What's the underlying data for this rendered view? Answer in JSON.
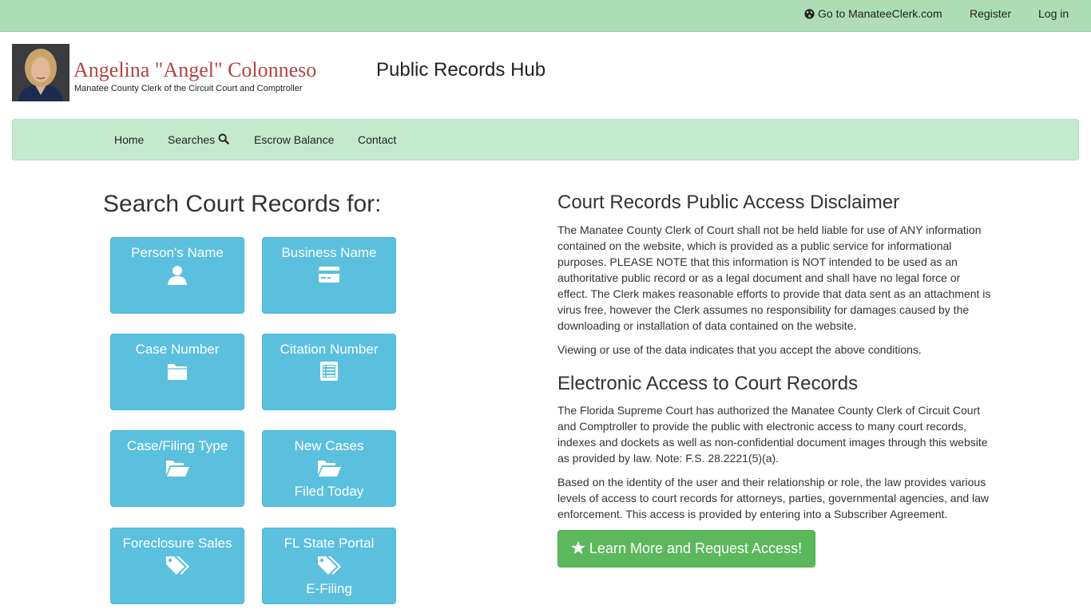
{
  "topbar": {
    "goto_label": "Go to ManateeClerk.com",
    "register_label": "Register",
    "login_label": "Log in"
  },
  "brand": {
    "name": "Angelina \"Angel\" Colonneso",
    "subtitle": "Manatee County Clerk of the Circuit Court and Comptroller",
    "hub_title": "Public Records Hub"
  },
  "nav": {
    "home": "Home",
    "searches": "Searches",
    "escrow": "Escrow Balance",
    "contact": "Contact"
  },
  "search": {
    "title": "Search Court Records for:",
    "tiles": [
      {
        "label": "Person's Name",
        "icon": "user-icon"
      },
      {
        "label": "Business Name",
        "icon": "credit-card-icon"
      },
      {
        "label": "Case Number",
        "icon": "folder-icon"
      },
      {
        "label": "Citation Number",
        "icon": "list-alt-icon"
      },
      {
        "label": "Case/Filing Type",
        "icon": "folder-open-icon"
      },
      {
        "label": "New Cases",
        "sublabel": "Filed Today",
        "icon": "folder-open-icon"
      },
      {
        "label": "Foreclosure Sales",
        "icon": "tags-icon"
      },
      {
        "label": "FL State Portal",
        "sublabel": "E-Filing",
        "icon": "tags-icon"
      }
    ]
  },
  "disclaimer": {
    "title": "Court Records Public Access Disclaimer",
    "p1": "The Manatee County Clerk of Court shall not be held liable for use of ANY information contained on the website, which is provided as a public service for informational purposes. PLEASE NOTE that this information is NOT intended to be used as an authoritative public record or as a legal document and shall have no legal force or effect. The Clerk makes reasonable efforts to provide that data sent as an attachment is virus free, however the Clerk assumes no responsibility for damages caused by the downloading or installation of data contained on the website.",
    "p2": "Viewing or use of the data indicates that you accept the above conditions."
  },
  "electronic": {
    "title": "Electronic Access to Court Records",
    "p1": "The Florida Supreme Court has authorized the Manatee County Clerk of Circuit Court and Comptroller to provide the public with electronic access to many court records, indexes and dockets as well as non-confidential document images through this website as provided by law. Note: F.S. 28.2221(5)(a).",
    "p2": "Based on the identity of the user and their relationship or role, the law provides various levels of access to court records for attorneys, parties, governmental agencies, and law enforcement. This access is provided by entering into a Subscriber Agreement.",
    "cta_label": "Learn More and Request Access!"
  },
  "colors": {
    "topbar": "#aeddb5",
    "navbar": "#c5e9cd",
    "tile": "#5bc0de",
    "cta": "#5cb85c",
    "brand_name": "#b3433f"
  }
}
